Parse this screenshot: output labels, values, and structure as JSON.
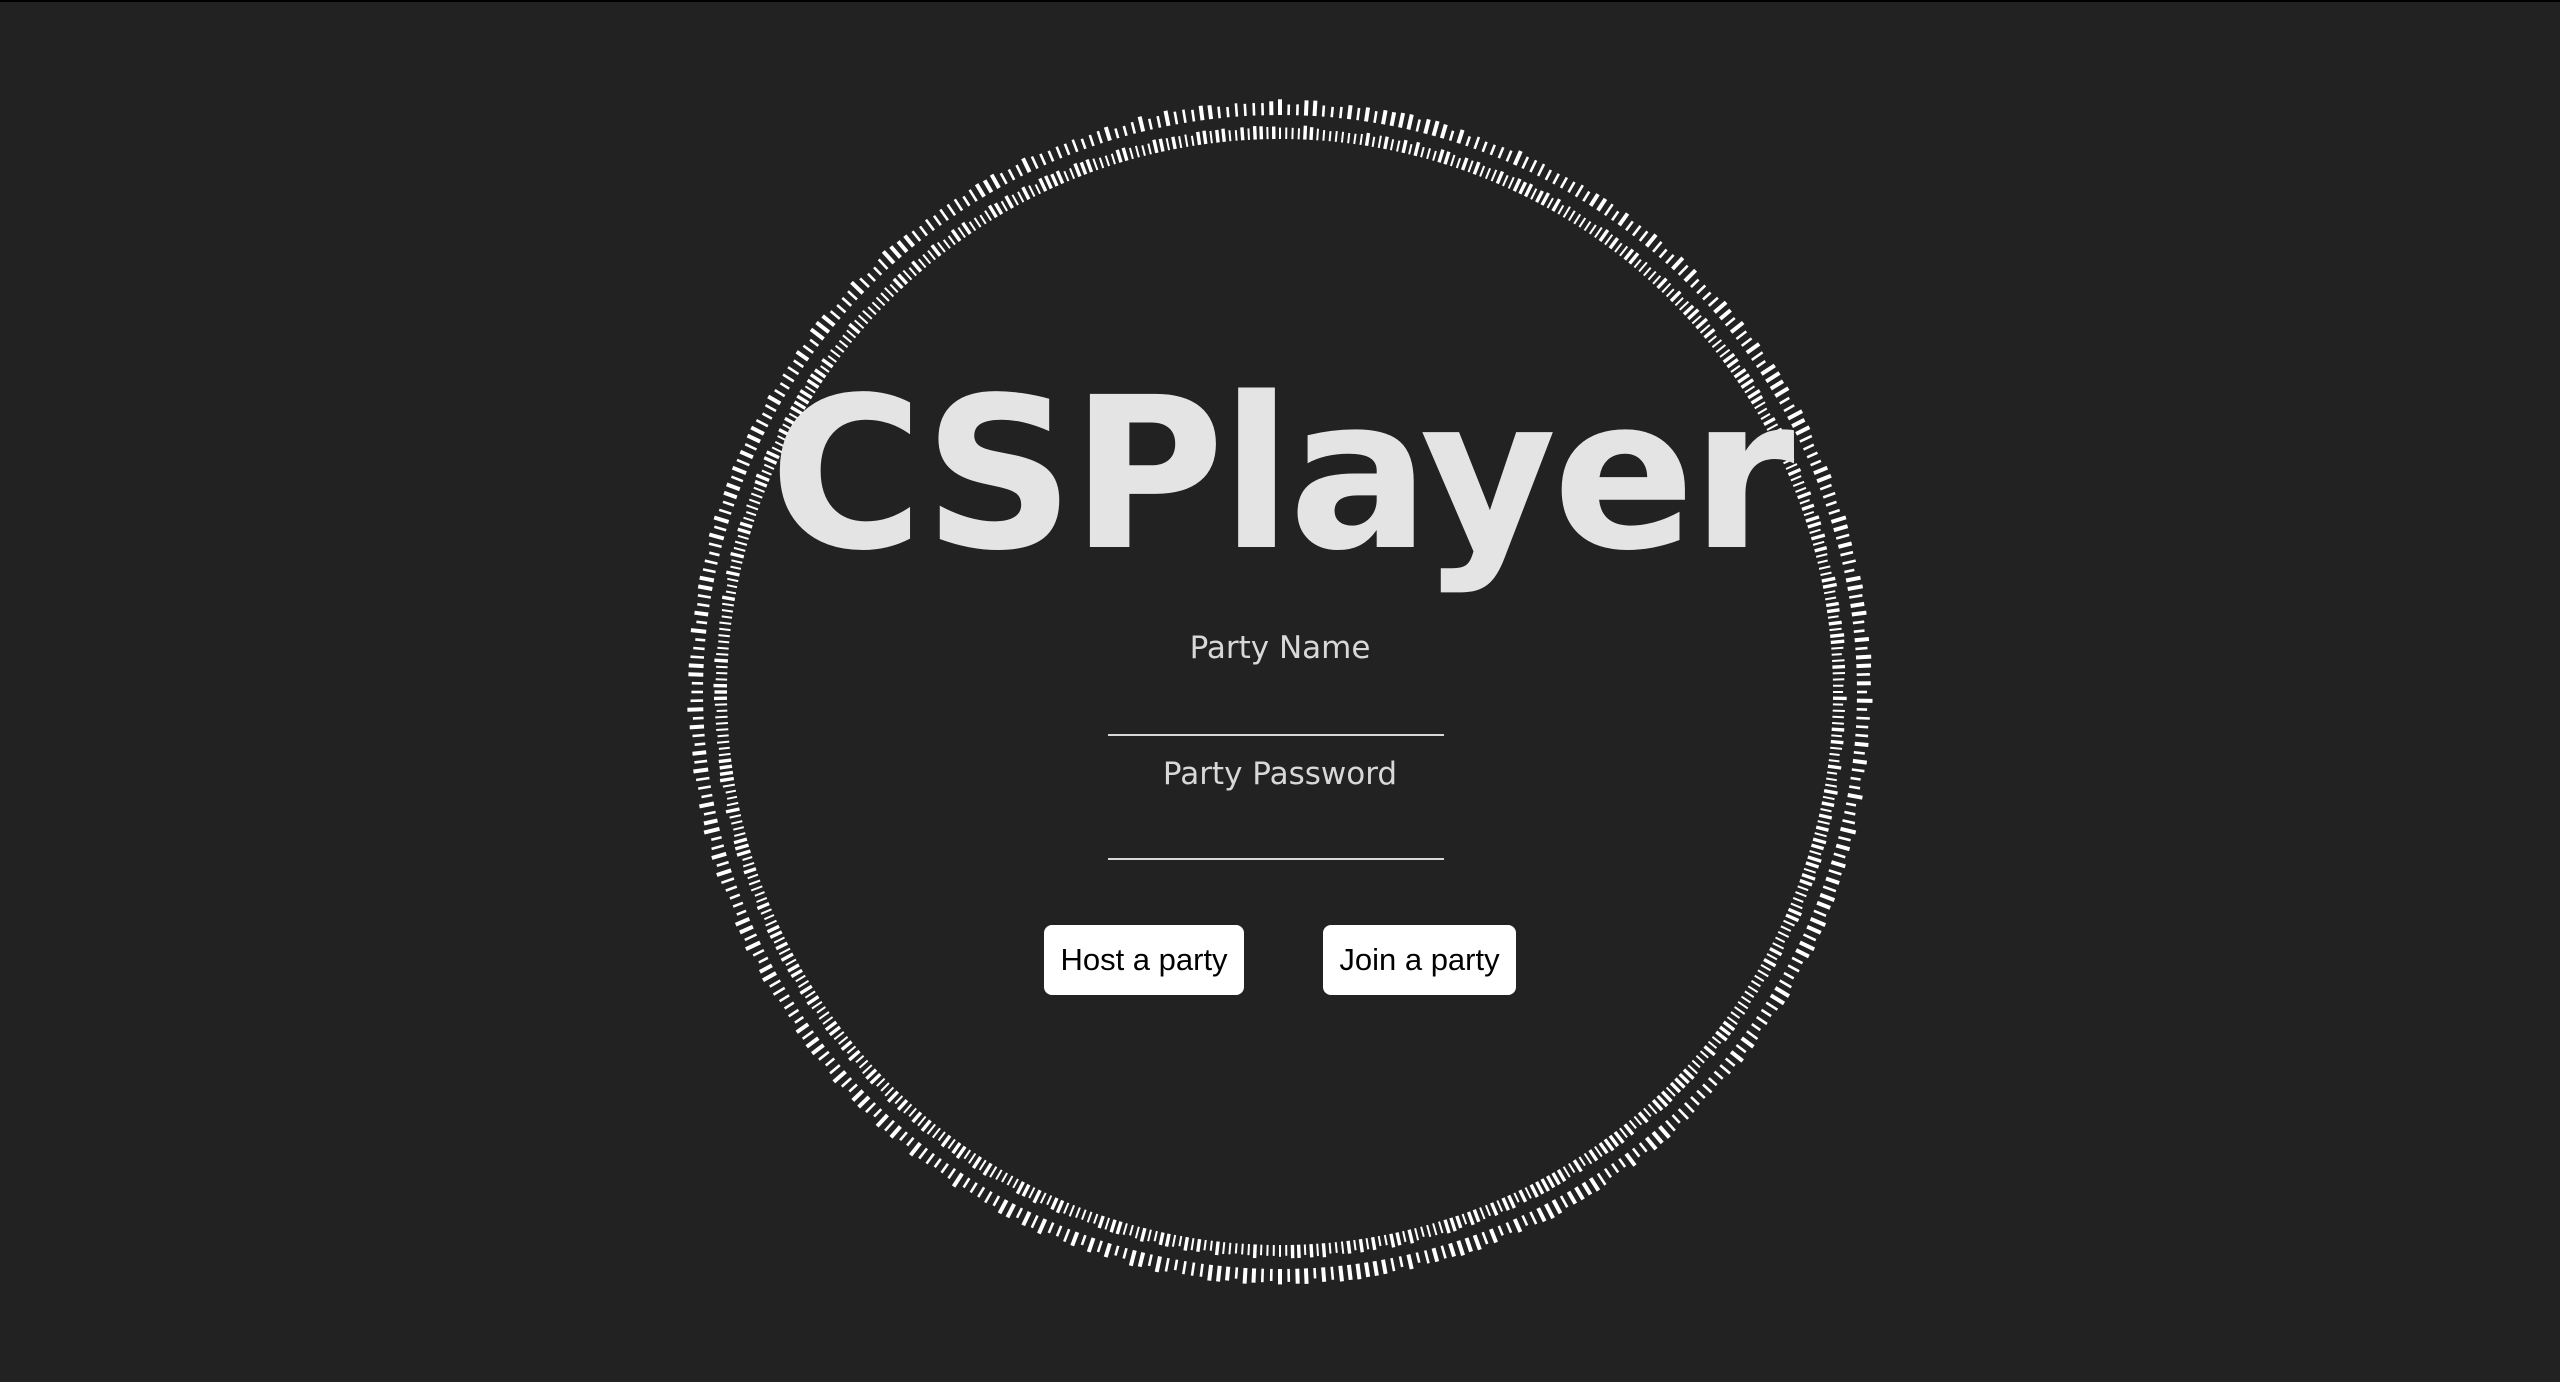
{
  "app": {
    "title": "CSPlayer"
  },
  "form": {
    "party_name_label": "Party Name",
    "party_name_value": "",
    "party_password_label": "Party Password",
    "party_password_value": ""
  },
  "actions": {
    "host_label": "Host a party",
    "join_label": "Join a party"
  },
  "colors": {
    "background": "#222222",
    "title": "#e4e4e4",
    "ring": "#ffffff",
    "button_bg": "#ffffff",
    "button_text": "#000000"
  }
}
